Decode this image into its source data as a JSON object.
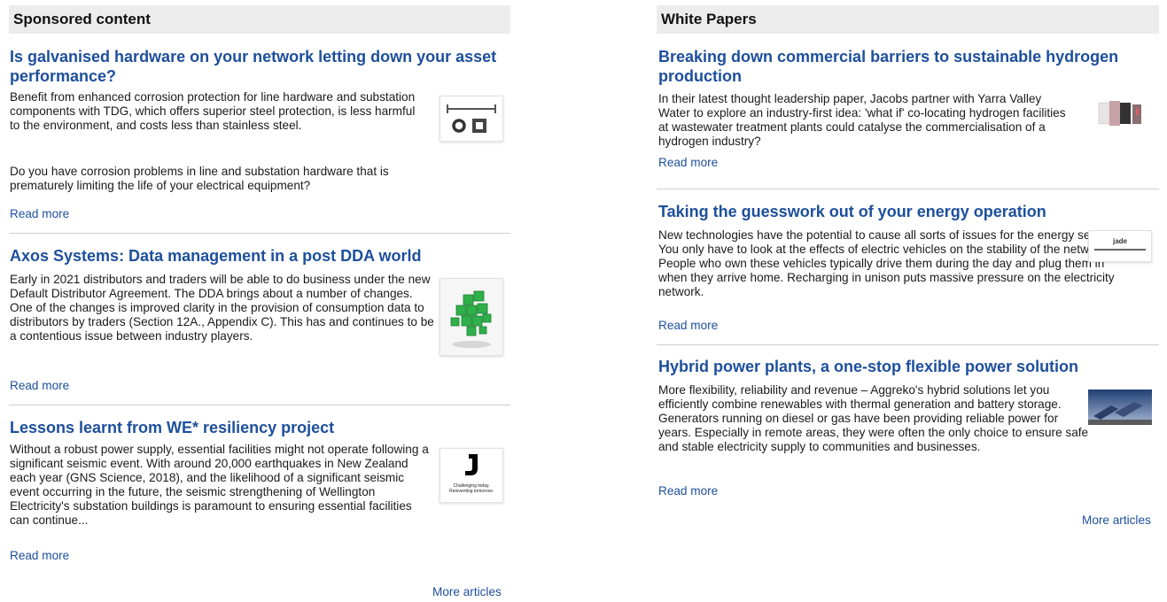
{
  "sponsored": {
    "header": "Sponsored content",
    "articles": [
      {
        "title": "Is galvanised hardware on your network letting down your asset performance?",
        "paragraphs": [
          "Benefit from enhanced corrosion protection for line hardware and substation components with TDG, which offers superior steel protection, is less harmful to the environment, and costs less than stainless steel.",
          "Do you have corrosion problems in line and substation hardware that is prematurely limiting the life of your electrical equipment?"
        ],
        "read_more": "Read more",
        "thumb_icon": "hardware-logo-icon"
      },
      {
        "title": "Axos Systems: Data management in a post DDA world",
        "paragraphs": [
          "Early in 2021 distributors and traders will be able to do business under the new Default Distributor Agreement. The DDA brings about a number of changes. One of the changes is improved clarity in the provision of consumption data to distributors by traders (Section 12A., Appendix C). This has and continues to be a contentious issue between industry players."
        ],
        "read_more": "Read more",
        "thumb_icon": "green-cubes-icon"
      },
      {
        "title": "Lessons learnt from WE* resiliency project",
        "paragraphs": [
          "Without a robust power supply, essential facilities might not operate following a significant seismic event. With around 20,000 earthquakes in New Zealand each year (GNS Science, 2018), and the likelihood of a significant seismic event occurring in the future, the seismic strengthening of Wellington Electricity's substation buildings is paramount to ensuring essential facilities can continue..."
        ],
        "read_more": "Read more",
        "thumb_icon": "j-logo-icon",
        "thumb_line1": "Challenging today.",
        "thumb_line2": "Reinventing tomorrow."
      }
    ],
    "more_articles": "More articles"
  },
  "white_papers": {
    "header": "White Papers",
    "articles": [
      {
        "title": "Breaking down commercial barriers to sustainable hydrogen production",
        "paragraphs": [
          "In their latest thought leadership paper, Jacobs partner with Yarra Valley Water to explore an industry-first idea: 'what if' co-locating hydrogen facilities at wastewater treatment plants could catalyse the commercialisation of a hydrogen industry?"
        ],
        "read_more": "Read more",
        "thumb_icon": "brochure-icon"
      },
      {
        "title": "Taking the guesswork out of your energy operation",
        "paragraphs": [
          "New technologies have the potential to cause all sorts of issues for the energy sector. You only have to look at the effects of electric vehicles on the stability of the network. People who own these vehicles typically drive them during the day and plug them in when they arrive home. Recharging in unison puts massive pressure on the electricity network."
        ],
        "read_more": "Read more",
        "thumb_icon": "jade-logo-icon",
        "thumb_word": "jade"
      },
      {
        "title": "Hybrid power plants, a one-stop flexible power solution",
        "paragraphs": [
          "More flexibility, reliability and revenue – Aggreko's hybrid solutions let you efficiently combine renewables with thermal generation and battery storage.   Generators running on diesel or gas have been providing reliable power for years. Especially in remote areas, they were often the only choice to ensure safe and stable electricity supply to communities and businesses."
        ],
        "read_more": "Read more",
        "thumb_icon": "solar-panels-icon"
      }
    ],
    "more_articles": "More articles"
  },
  "colors": {
    "link": "#1d4f9c",
    "header_bg": "#ececec",
    "divider": "#cfcfcf",
    "text": "#1a1a1a"
  }
}
